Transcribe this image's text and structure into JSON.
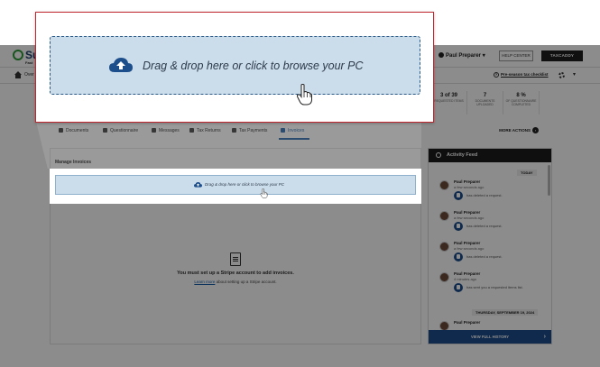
{
  "app": {
    "logo_text": "Su",
    "logo_sub": "Fast",
    "user_name": "Paul Preparer",
    "help_center": "HELP CENTER",
    "taxcaddy": "TAXCADDY",
    "breadcrumb": "Over",
    "checklist_link": "Pre-season tax checklist"
  },
  "stats": [
    {
      "value": "3 of 39",
      "label": "REQUESTED ITEMS"
    },
    {
      "value": "7",
      "label": "DOCUMENTS UPLOADED"
    },
    {
      "value": "8 %",
      "label": "OF QUESTIONNAIRE COMPLETED"
    }
  ],
  "tabs": [
    {
      "label": "Documents"
    },
    {
      "label": "Questionnaire"
    },
    {
      "label": "Messages"
    },
    {
      "label": "Tax Returns"
    },
    {
      "label": "Tax Payments"
    },
    {
      "label": "Invoices",
      "active": true
    }
  ],
  "more_actions": "MORE ACTIONS",
  "invoices": {
    "title": "Manage Invoices",
    "dropzone_label": "Drag & drop here or click to browse your PC",
    "empty_message": "You must set up a Stripe account to add invoices.",
    "learn_more": "Learn more",
    "learn_more_suffix": " about setting up a Stripe account."
  },
  "feed": {
    "title": "Activity Feed",
    "today_label": "TODAY",
    "date_label": "THURSDAY, SEPTEMBER 19, 2024",
    "items": [
      {
        "name": "Paul Preparer",
        "time": "a few seconds ago",
        "action": "has deleted a request."
      },
      {
        "name": "Paul Preparer",
        "time": "a few seconds ago",
        "action": "has deleted a request."
      },
      {
        "name": "Paul Preparer",
        "time": "a few seconds ago",
        "action": "has deleted a request."
      },
      {
        "name": "Paul Preparer",
        "time": "4 minutes ago",
        "action": "has sent you a requested items list."
      },
      {
        "name": "Paul Preparer",
        "time": "",
        "action": ""
      }
    ],
    "view_history": "VIEW FULL HISTORY"
  },
  "colors": {
    "accent": "#1c4e8c",
    "dropzone": "#cbdcea",
    "callout_border": "#c0262d"
  }
}
